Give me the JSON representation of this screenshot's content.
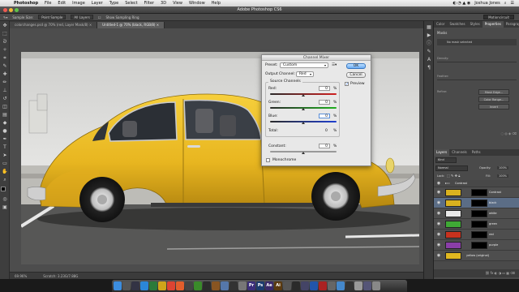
{
  "menubar": {
    "app_name": "Photoshop",
    "items": [
      "File",
      "Edit",
      "Image",
      "Layer",
      "Type",
      "Select",
      "Filter",
      "3D",
      "View",
      "Window",
      "Help"
    ],
    "user": "Joshua Jones"
  },
  "window": {
    "title": "Adobe Photoshop CS6"
  },
  "options": {
    "sample_size": "Sample Size:",
    "sample_value": "Point Sample",
    "sample_layers": "All Layers",
    "show_ring": "Show Sampling Ring",
    "workspace": "Motioncircuit"
  },
  "tabs": [
    {
      "label": "colorchanges.psd @ 70% (red, Layer Mask/8) ×"
    },
    {
      "label": "Untitled-1 @ 70% (black, RGB/8) ×"
    }
  ],
  "status": {
    "zoom": "69.96%",
    "doc": "Scratch: 3.23G/7.88G"
  },
  "right_panel": {
    "tabs": [
      "Color",
      "Swatches",
      "Styles",
      "Properties",
      "Paragraph"
    ],
    "masks_label": "Masks",
    "no_mask": "No mask selected",
    "density_label": "Density:",
    "feather_label": "Feather:",
    "refine_label": "Refine:",
    "btn_mask_edge": "Mask Edge...",
    "btn_color_range": "Color Range...",
    "btn_invert": "Invert",
    "layer_tabs": [
      "Layers",
      "Channels",
      "Paths"
    ],
    "kind_label": "Kind",
    "blend": "Normal",
    "opacity_label": "Opacity:",
    "opacity_value": "100%",
    "lock_label": "Lock:",
    "fill_label": "Fill:",
    "fill_value": "100%",
    "group_name": "Contrast",
    "layers": [
      {
        "name": "Contrast",
        "color": "#d9b21f",
        "selected": false,
        "group": true
      },
      {
        "name": "black",
        "color": "#d9b21f",
        "selected": true
      },
      {
        "name": "white",
        "color": "#e8e8e8",
        "selected": false
      },
      {
        "name": "green",
        "color": "#3fa935",
        "selected": false
      },
      {
        "name": "red",
        "color": "#c8321e",
        "selected": false
      },
      {
        "name": "purple",
        "color": "#8a3ea8",
        "selected": false
      },
      {
        "name": "yellow (original)",
        "color": "#e0b820",
        "selected": false
      }
    ]
  },
  "dialog": {
    "title": "Channel Mixer",
    "preset_label": "Preset:",
    "preset_value": "Custom",
    "output_label": "Output Channel:",
    "output_value": "Red",
    "source_label": "Source Channels",
    "red_label": "Red:",
    "red_value": "0",
    "green_label": "Green:",
    "green_value": "0",
    "blue_label": "Blue:",
    "blue_value": "0",
    "total_label": "Total:",
    "total_value": "0",
    "constant_label": "Constant:",
    "constant_value": "0",
    "monochrome_label": "Monochrome",
    "percent": "%",
    "ok": "OK",
    "cancel": "Cancel",
    "preview": "Preview"
  },
  "dock_icons": [
    {
      "name": "finder-icon",
      "color": "#3c8dde",
      "label": ""
    },
    {
      "name": "launchpad-icon",
      "color": "#555",
      "label": ""
    },
    {
      "name": "mission-control-icon",
      "color": "#334",
      "label": ""
    },
    {
      "name": "safari-icon",
      "color": "#2b86d8",
      "label": ""
    },
    {
      "name": "app-icon-1",
      "color": "#2a7a3a",
      "label": ""
    },
    {
      "name": "app-icon-2",
      "color": "#cfa51a",
      "label": ""
    },
    {
      "name": "chrome-icon",
      "color": "#dd4433",
      "label": ""
    },
    {
      "name": "app-icon-3",
      "color": "#e35e2c",
      "label": ""
    },
    {
      "name": "app-icon-4",
      "color": "#444",
      "label": ""
    },
    {
      "name": "xbox-icon",
      "color": "#3a8a2a",
      "label": ""
    },
    {
      "name": "app-icon-5",
      "color": "#2c2c2c",
      "label": ""
    },
    {
      "name": "app-icon-6",
      "color": "#885522",
      "label": ""
    },
    {
      "name": "app-icon-7",
      "color": "#5577aa",
      "label": ""
    },
    {
      "name": "app-icon-8",
      "color": "#333",
      "label": ""
    },
    {
      "name": "app-icon-9",
      "color": "#777",
      "label": ""
    },
    {
      "name": "premiere-icon",
      "color": "#3b2e7a",
      "label": "Pr"
    },
    {
      "name": "photoshop-icon",
      "color": "#1c3b6e",
      "label": "Ps"
    },
    {
      "name": "aftereffects-icon",
      "color": "#3a2a6a",
      "label": "Ae"
    },
    {
      "name": "illustrator-icon",
      "color": "#5a3a10",
      "label": "Ai"
    },
    {
      "name": "app-icon-10",
      "color": "#555",
      "label": ""
    },
    {
      "name": "app-icon-11",
      "color": "#2a2a2a",
      "label": ""
    },
    {
      "name": "app-icon-12",
      "color": "#446",
      "label": ""
    },
    {
      "name": "app-icon-13",
      "color": "#2255aa",
      "label": ""
    },
    {
      "name": "app-icon-14",
      "color": "#aa2222",
      "label": ""
    },
    {
      "name": "app-icon-15",
      "color": "#666",
      "label": ""
    },
    {
      "name": "app-icon-16",
      "color": "#4488cc",
      "label": ""
    },
    {
      "name": "app-icon-17",
      "color": "#333",
      "label": ""
    },
    {
      "name": "app-icon-18",
      "color": "#999",
      "label": ""
    },
    {
      "name": "app-icon-19",
      "color": "#557",
      "label": ""
    },
    {
      "name": "trash-icon",
      "color": "#888",
      "label": ""
    }
  ]
}
